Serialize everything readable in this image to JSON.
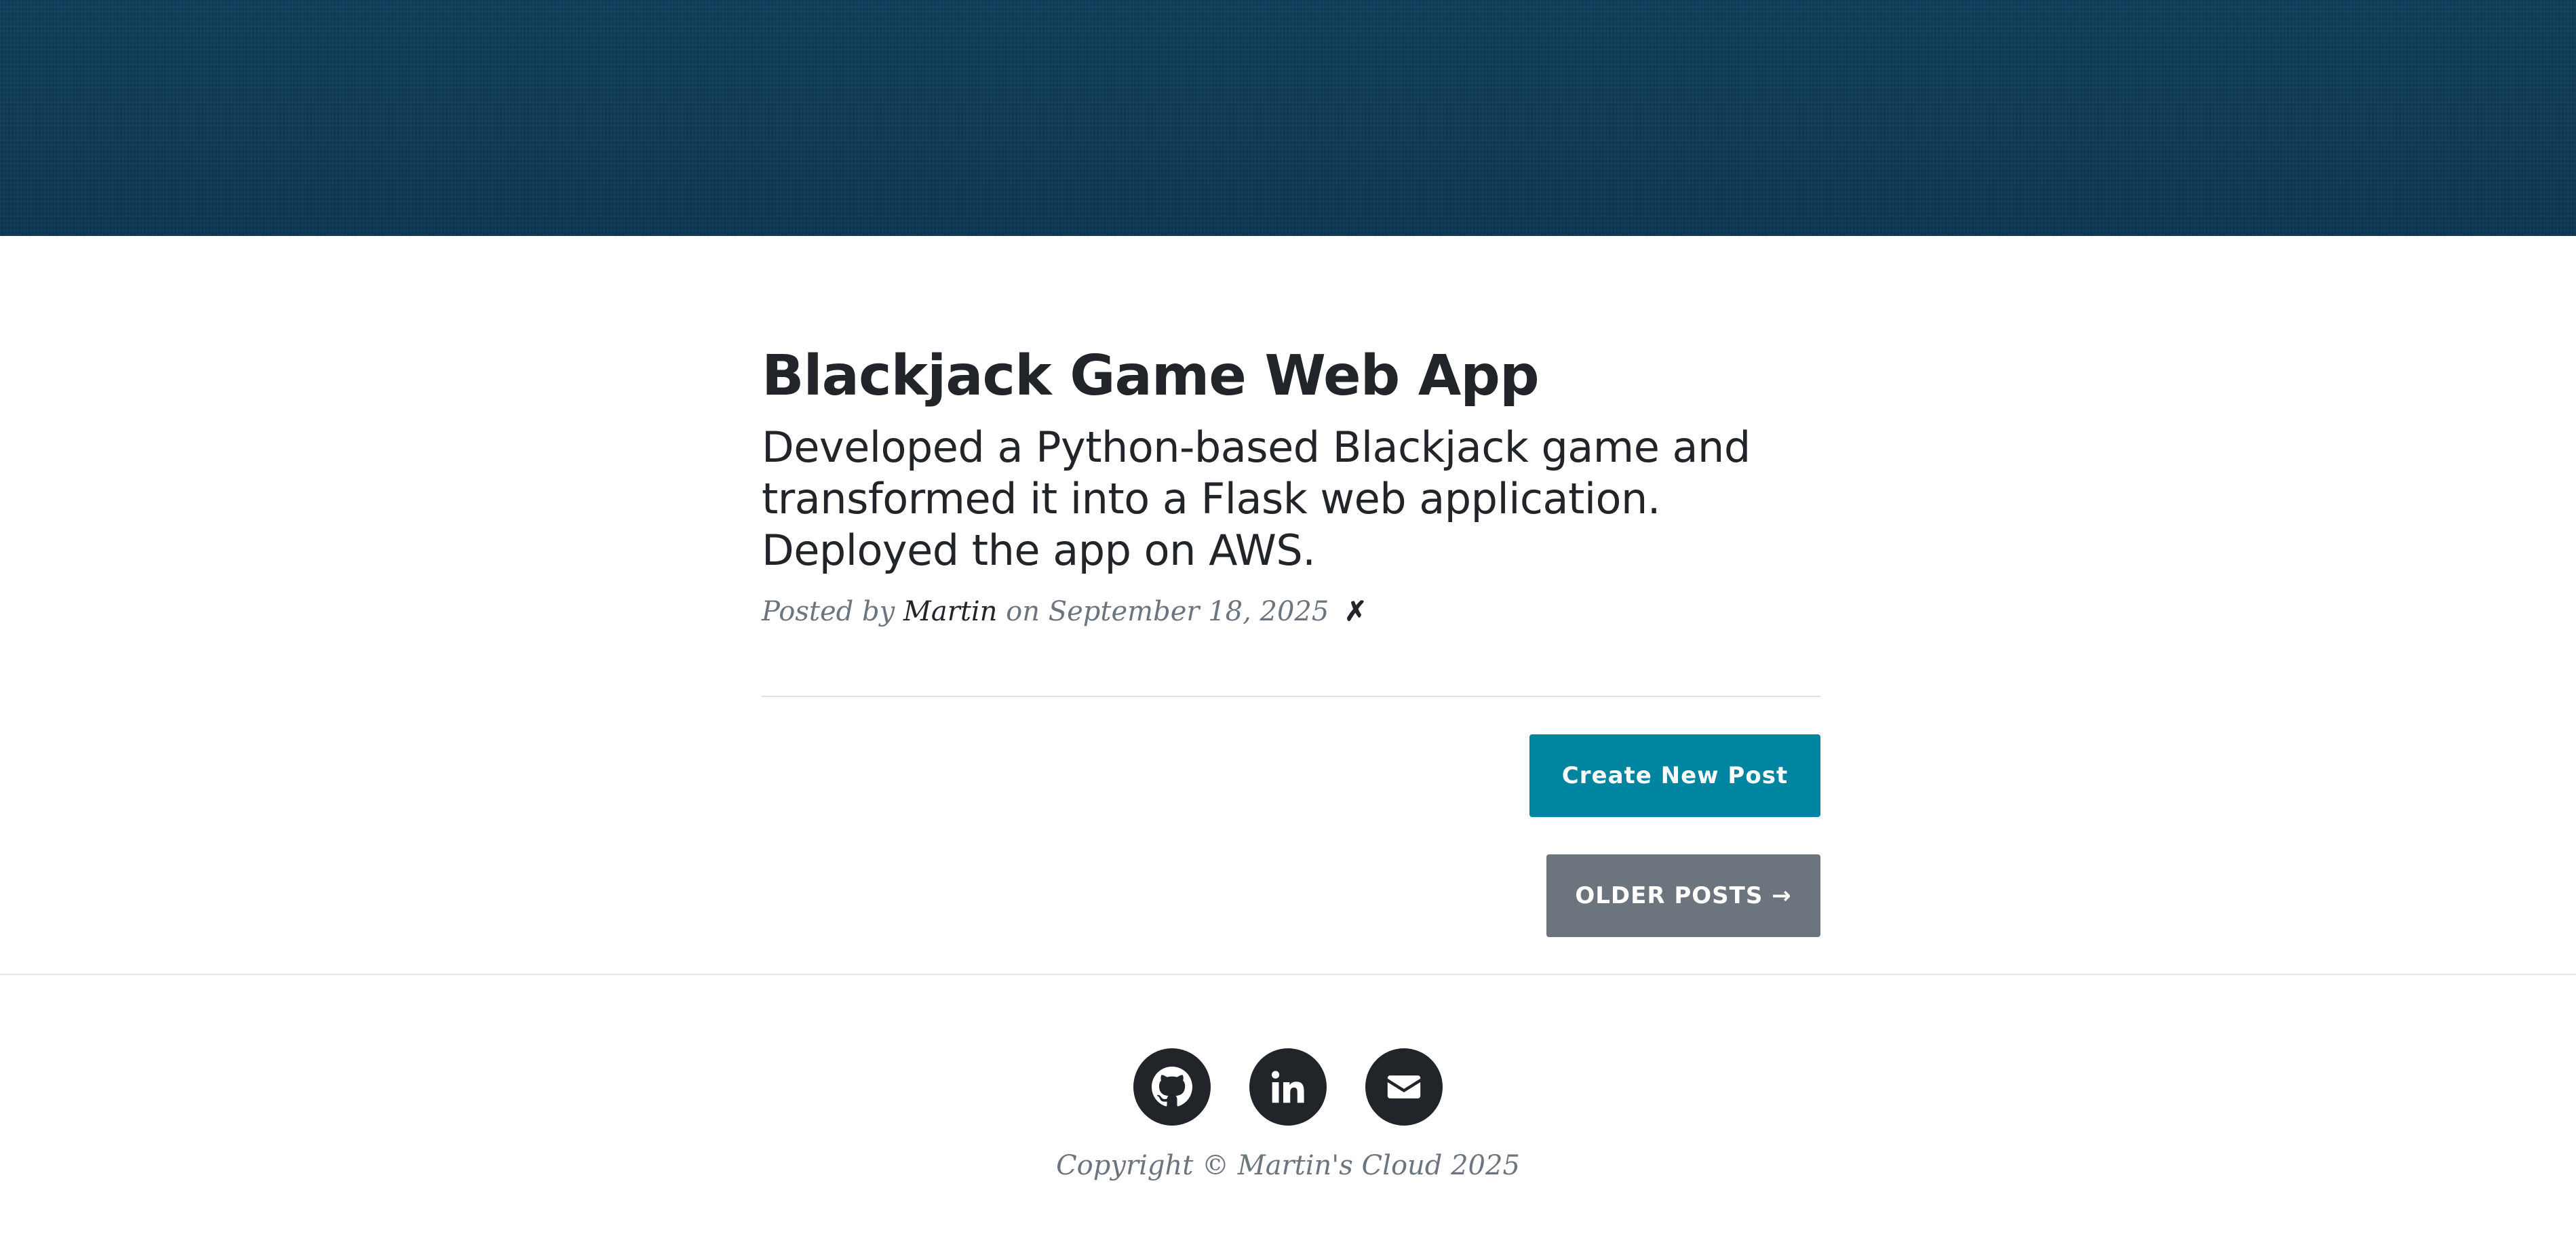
{
  "colors": {
    "hero_background": "#0e3a57",
    "create_button": "#0085a1",
    "older_button": "#6c757d",
    "heading_text": "#212529",
    "meta_text": "#6c757d",
    "social_icon_bg": "#212529"
  },
  "post": {
    "title": "Blackjack Game Web App",
    "subtitle": "Developed a Python-based Blackjack game and transformed it into a Flask web application. Deployed the app on AWS.",
    "meta_prefix": "Posted by",
    "author": "Martin",
    "meta_on": "on",
    "date": "September 18, 2025",
    "delete_symbol": "✗"
  },
  "actions": {
    "create_label": "Create New Post",
    "older_label": "OLDER POSTS →"
  },
  "footer": {
    "social": [
      {
        "icon": "github-icon"
      },
      {
        "icon": "linkedin-icon"
      },
      {
        "icon": "envelope-icon"
      }
    ],
    "copyright": "Copyright © Martin's Cloud 2025"
  }
}
